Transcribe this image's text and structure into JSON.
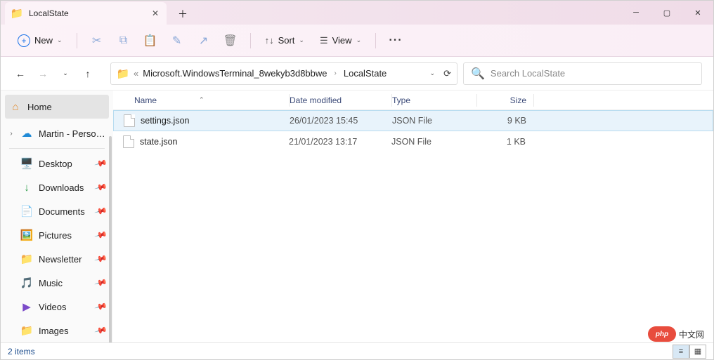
{
  "tab": {
    "title": "LocalState"
  },
  "toolbar": {
    "new_label": "New",
    "sort_label": "Sort",
    "view_label": "View"
  },
  "address": {
    "parts": [
      "Microsoft.WindowsTerminal_8wekyb3d8bbwe",
      "LocalState"
    ]
  },
  "search": {
    "placeholder": "Search LocalState"
  },
  "sidebar": {
    "home": "Home",
    "onedrive": "Martin - Persona",
    "quick": [
      {
        "label": "Desktop",
        "icon": "🖥️"
      },
      {
        "label": "Downloads",
        "icon": "↓"
      },
      {
        "label": "Documents",
        "icon": "📄"
      },
      {
        "label": "Pictures",
        "icon": "🖼️"
      },
      {
        "label": "Newsletter",
        "icon": "📁"
      },
      {
        "label": "Music",
        "icon": "🎵"
      },
      {
        "label": "Videos",
        "icon": "▶"
      },
      {
        "label": "Images",
        "icon": "📁"
      }
    ]
  },
  "columns": {
    "name": "Name",
    "date": "Date modified",
    "type": "Type",
    "size": "Size"
  },
  "files": [
    {
      "name": "settings.json",
      "date": "26/01/2023 15:45",
      "type": "JSON File",
      "size": "9 KB",
      "selected": true
    },
    {
      "name": "state.json",
      "date": "21/01/2023 13:17",
      "type": "JSON File",
      "size": "1 KB",
      "selected": false
    }
  ],
  "status": {
    "count": "2 items"
  },
  "watermark": {
    "badge": "php",
    "text": "中文网"
  }
}
